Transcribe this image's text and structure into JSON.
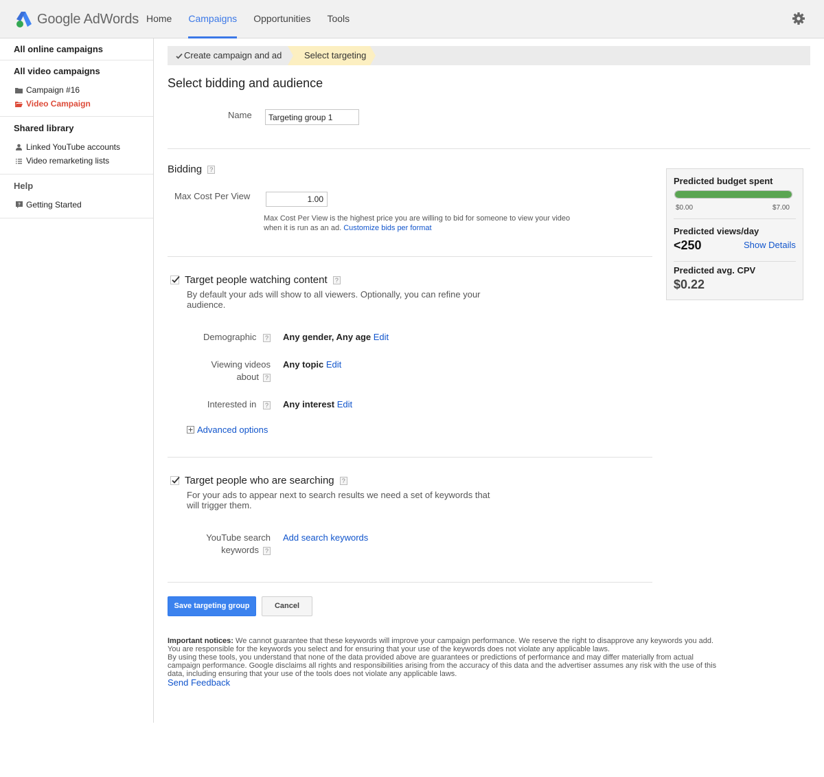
{
  "header": {
    "brand_google": "Google",
    "brand_product": "AdWords",
    "nav": [
      "Home",
      "Campaigns",
      "Opportunities",
      "Tools"
    ],
    "active_nav": "Campaigns",
    "settings_icon": "gear-icon"
  },
  "sidebar": {
    "all_online": "All online campaigns",
    "all_video": "All video campaigns",
    "campaigns": [
      {
        "label": "Campaign #16",
        "icon": "folder-icon"
      },
      {
        "label": "Video Campaign",
        "icon": "folder-open-icon",
        "active": true
      }
    ],
    "shared_library": "Shared library",
    "shared_items": [
      {
        "label": "Linked YouTube accounts",
        "icon": "person-icon"
      },
      {
        "label": "Video remarketing lists",
        "icon": "list-icon"
      }
    ],
    "help": "Help",
    "help_items": [
      {
        "label": "Getting Started",
        "icon": "help-bubble-icon"
      }
    ]
  },
  "breadcrumb": {
    "step1": "Create campaign and ad",
    "step2": "Select targeting"
  },
  "page": {
    "title": "Select bidding and audience",
    "name_label": "Name",
    "name_value": "Targeting group 1"
  },
  "bidding": {
    "title": "Bidding",
    "help": "?",
    "max_cpv_label": "Max Cost Per View",
    "max_cpv_value": "1.00",
    "note": "Max Cost Per View is the highest price you are willing to bid for someone to view your video when it is run as an ad.",
    "note_link": "Customize bids per format"
  },
  "content_targeting": {
    "checked": true,
    "title": "Target people watching content",
    "desc": "By default your ads will show to all viewers. Optionally, you can refine your audience.",
    "rows": [
      {
        "label": "Demographic",
        "value": "Any gender, Any age",
        "action": "Edit"
      },
      {
        "label": "Viewing videos about",
        "value": "Any topic",
        "action": "Edit"
      },
      {
        "label": "Interested in",
        "value": "Any interest",
        "action": "Edit"
      }
    ],
    "advanced": "Advanced options"
  },
  "search_targeting": {
    "checked": true,
    "title": "Target people who are searching",
    "desc": "For your ads to appear next to search results we need a set of keywords that will trigger them.",
    "row_label": "YouTube search keywords",
    "row_action": "Add search keywords"
  },
  "actions": {
    "save": "Save targeting group",
    "cancel": "Cancel"
  },
  "notices": {
    "lead": "Important notices:",
    "text1": "We cannot guarantee that these keywords will improve your campaign performance. We reserve the right to disapprove any keywords you add. You are responsible for the keywords you select and for ensuring that your use of the keywords does not violate any applicable laws.",
    "text2": "By using these tools, you understand that none of the data provided above are guarantees or predictions of performance and may differ materially from actual campaign performance. Google disclaims all rights and responsibilities arising from the accuracy of this data and the advertiser assumes any risk with the use of this data, including ensuring that your use of the tools does not violate any applicable laws.",
    "feedback": "Send Feedback"
  },
  "predicted": {
    "budget_title": "Predicted budget spent",
    "budget_fill": 1.0,
    "budget_min": "$0.00",
    "budget_max": "$7.00",
    "views_title": "Predicted views/day",
    "views_value": "<250",
    "views_link": "Show Details",
    "cpv_title": "Predicted avg. CPV",
    "cpv_value": "$0.22"
  },
  "colors": {
    "accent": "#3b78e7",
    "active_red": "#dd4b39",
    "bar_green": "#5aa552",
    "link": "#1155cc"
  }
}
